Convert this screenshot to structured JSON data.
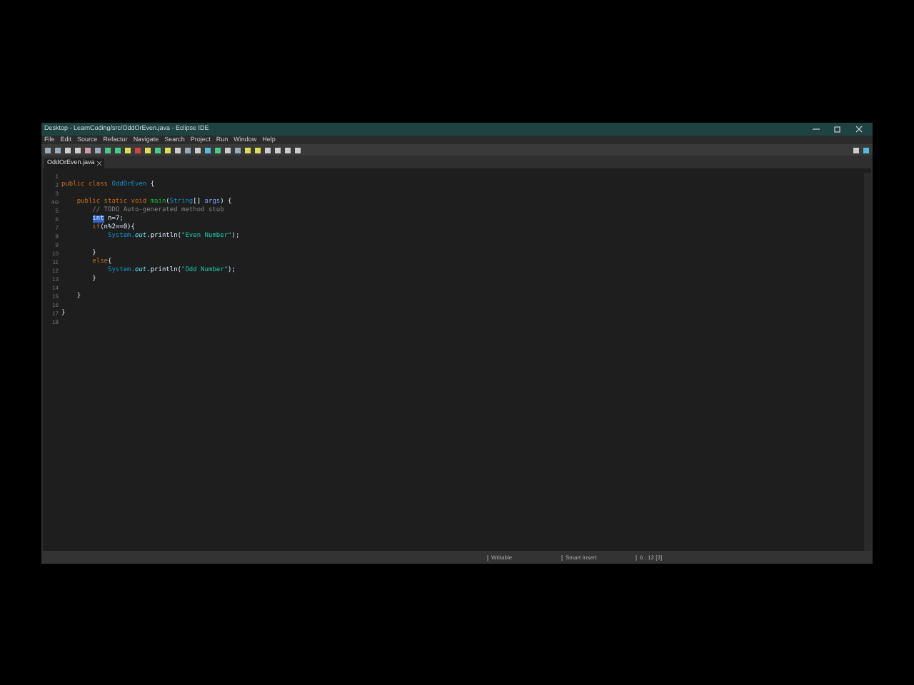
{
  "window": {
    "title": "Desktop - LearnCoding/src/OddOrEven.java - Eclipse IDE"
  },
  "menu": [
    "File",
    "Edit",
    "Source",
    "Refactor",
    "Navigate",
    "Search",
    "Project",
    "Run",
    "Window",
    "Help"
  ],
  "tabs": [
    {
      "label": "OddOrEven.java",
      "selected": true
    }
  ],
  "editor": {
    "lines": [
      {
        "number": "1"
      },
      {
        "number": "2",
        "tokens": [
          {
            "text": "public class ",
            "kind": "keyword"
          },
          {
            "text": "OddOrEven",
            "kind": "type"
          },
          {
            "text": " {",
            "kind": "plain"
          }
        ]
      },
      {
        "number": "3"
      },
      {
        "number": "4⊖",
        "tokens": [
          {
            "text": "    public static void ",
            "kind": "keyword"
          },
          {
            "text": "main",
            "kind": "method"
          },
          {
            "text": "(",
            "kind": "plain"
          },
          {
            "text": "String",
            "kind": "type"
          },
          {
            "text": "[] ",
            "kind": "plain"
          },
          {
            "text": "args",
            "kind": "param"
          },
          {
            "text": ") {",
            "kind": "plain"
          }
        ]
      },
      {
        "number": "5",
        "tokens": [
          {
            "text": "        // TODO Auto-generated method stub",
            "kind": "comment"
          }
        ]
      },
      {
        "number": "6",
        "tokens": [
          {
            "text": "int",
            "kind": "selection"
          },
          {
            "text": " n=7;",
            "kind": "plain"
          }
        ]
      },
      {
        "number": "7",
        "tokens": [
          {
            "text": "        if",
            "kind": "keyword"
          },
          {
            "text": "(n%2==0){",
            "kind": "plain"
          }
        ]
      },
      {
        "number": "8",
        "tokens": [
          {
            "text": "            System.",
            "kind": "type"
          },
          {
            "text": "out",
            "kind": "field"
          },
          {
            "text": ".println(",
            "kind": "plain"
          },
          {
            "text": "\"Even Number\"",
            "kind": "string"
          },
          {
            "text": ");",
            "kind": "plain"
          }
        ]
      },
      {
        "number": "9"
      },
      {
        "number": "10",
        "tokens": [
          {
            "text": "        }",
            "kind": "plain"
          }
        ]
      },
      {
        "number": "11",
        "tokens": [
          {
            "text": "        else",
            "kind": "keyword"
          },
          {
            "text": "{",
            "kind": "plain"
          }
        ]
      },
      {
        "number": "12",
        "tokens": [
          {
            "text": "            System.",
            "kind": "type"
          },
          {
            "text": "out",
            "kind": "field"
          },
          {
            "text": ".println(",
            "kind": "plain"
          },
          {
            "text": "\"Odd Number\"",
            "kind": "string"
          },
          {
            "text": ");",
            "kind": "plain"
          }
        ]
      },
      {
        "number": "13",
        "tokens": [
          {
            "text": "        }",
            "kind": "plain"
          }
        ]
      },
      {
        "number": "14"
      },
      {
        "number": "15",
        "tokens": [
          {
            "text": "    }",
            "kind": "plain"
          }
        ]
      },
      {
        "number": "16"
      },
      {
        "number": "17",
        "tokens": [
          {
            "text": "}",
            "kind": "plain"
          }
        ]
      },
      {
        "number": "18"
      }
    ]
  },
  "status_bar": [
    "Writable",
    "Smart Insert",
    "6 : 12 [3]"
  ]
}
